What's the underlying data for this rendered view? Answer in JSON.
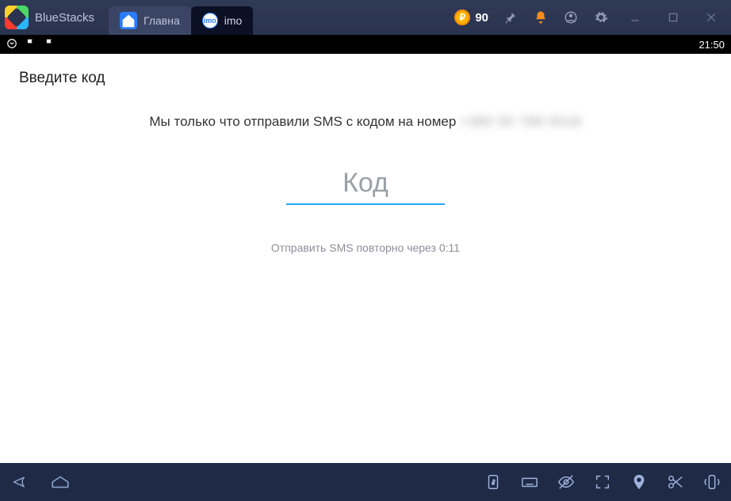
{
  "titlebar": {
    "app_name": "BlueStacks",
    "tabs": [
      {
        "label": "Главна"
      },
      {
        "label": "imo"
      }
    ],
    "coin_symbol": "₽",
    "coin_count": "90"
  },
  "statusbar": {
    "time": "21:50"
  },
  "page": {
    "title": "Введите код",
    "sms_message": "Мы только что отправили SMS с кодом на номер",
    "phone_masked": "+380 50 788 0018",
    "code_placeholder": "Код",
    "resend_prefix": "Отправить SMS повторно через ",
    "resend_timer": "0:11"
  }
}
